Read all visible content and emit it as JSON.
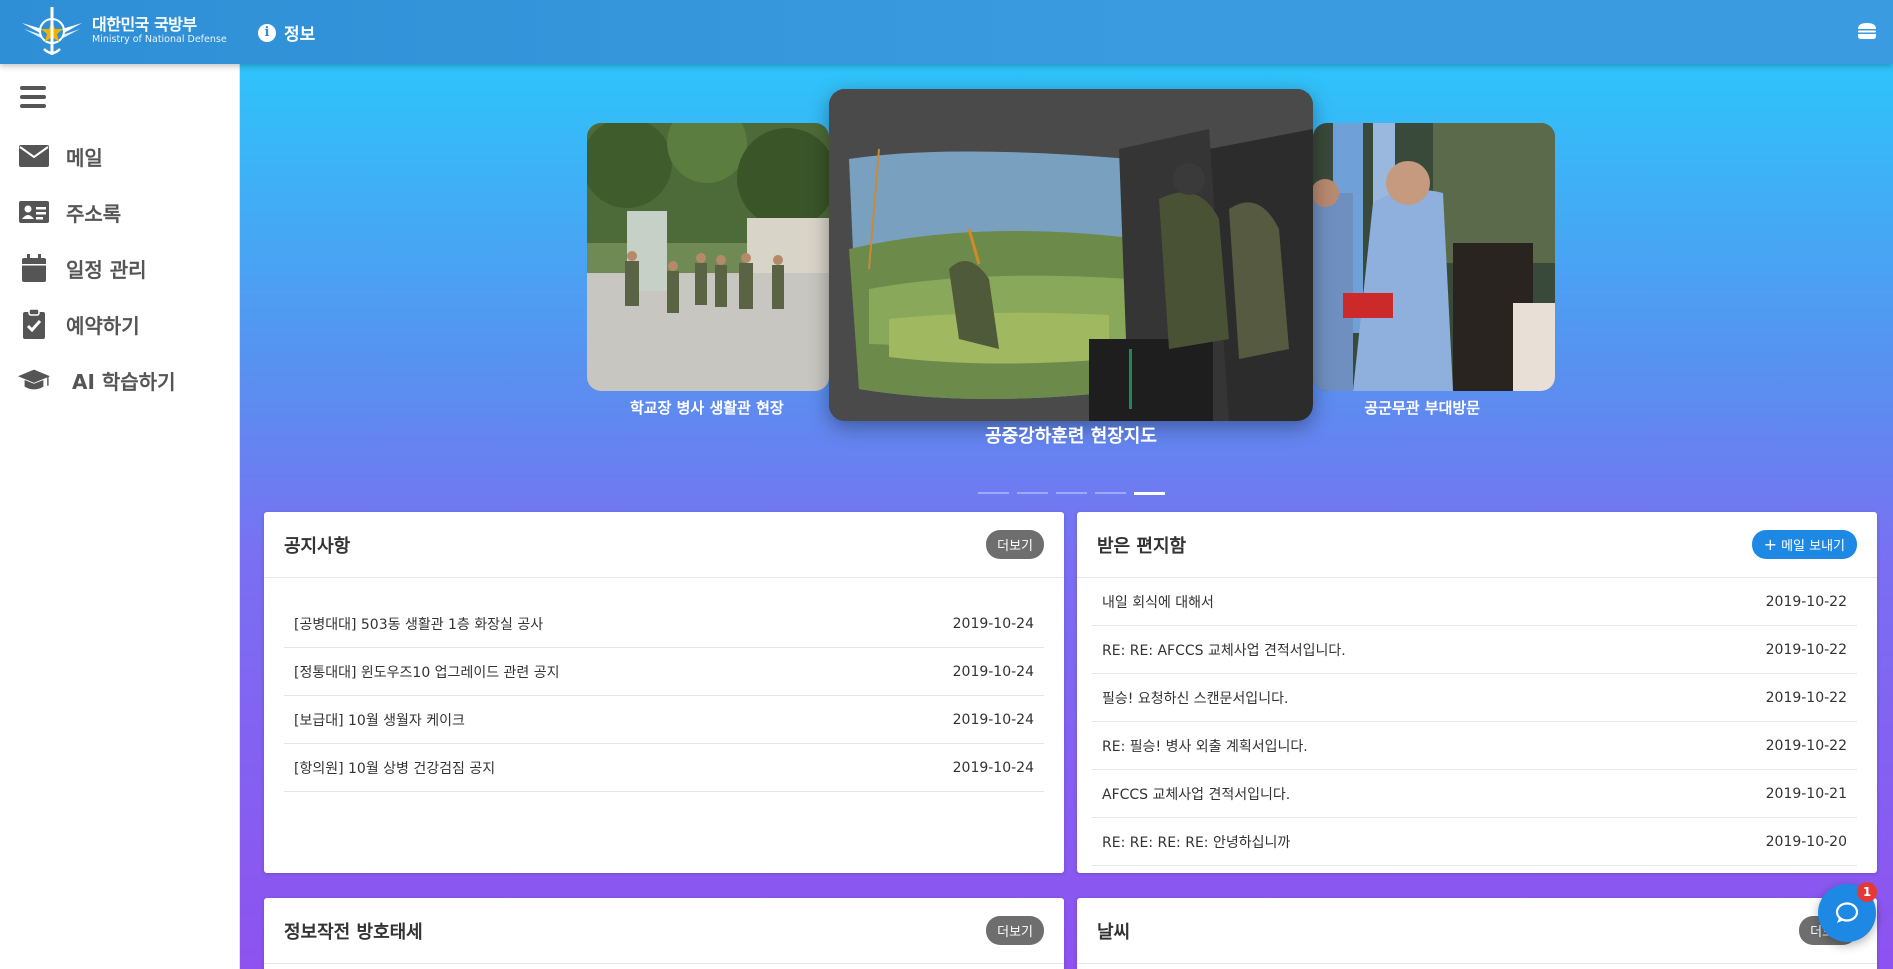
{
  "header": {
    "logo_ko": "대한민국 국방부",
    "logo_en": "Ministry of National Defense",
    "info_label": "정보",
    "info_icon": "info-circle-icon",
    "menu_icon": "hamburger-icon",
    "bg_color": "#2f8fd6"
  },
  "sidebar": {
    "items": [
      {
        "label": "메일",
        "icon": "envelope-icon"
      },
      {
        "label": "주소록",
        "icon": "address-card-icon"
      },
      {
        "label": "일정 관리",
        "icon": "calendar-icon"
      },
      {
        "label": "예약하기",
        "icon": "clipboard-check-icon"
      },
      {
        "label": "AI 학습하기",
        "icon": "graduation-cap-icon"
      }
    ]
  },
  "carousel": {
    "left_caption": "학교장 병사 생활관 현장",
    "center_caption": "공중강하훈련 현장지도",
    "right_caption": "공군무관 부대방문",
    "slide_count": 5,
    "active_index": 4
  },
  "notices": {
    "title": "공지사항",
    "more_label": "더보기",
    "rows": [
      {
        "title": "[공병대대] 503동 생활관 1층 화장실 공사",
        "date": "2019-10-24"
      },
      {
        "title": "[정통대대] 윈도우즈10 업그레이드 관련 공지",
        "date": "2019-10-24"
      },
      {
        "title": "[보급대] 10월 생월자 케이크",
        "date": "2019-10-24"
      },
      {
        "title": "[항의원] 10월 상병 건강검짐 공지",
        "date": "2019-10-24"
      }
    ]
  },
  "inbox": {
    "title": "받은 편지함",
    "send_label": "메일 보내기",
    "rows": [
      {
        "title": "내일 회식에 대해서",
        "date": "2019-10-22"
      },
      {
        "title": "RE: RE: AFCCS 교체사업 견적서입니다.",
        "date": "2019-10-22"
      },
      {
        "title": "필승! 요청하신 스캔문서입니다.",
        "date": "2019-10-22"
      },
      {
        "title": "RE: 필승! 병사 외출 계획서입니다.",
        "date": "2019-10-22"
      },
      {
        "title": "AFCCS 교체사업 견적서입니다.",
        "date": "2019-10-21"
      },
      {
        "title": "RE: RE: RE: RE: 안녕하십니까",
        "date": "2019-10-20"
      }
    ]
  },
  "infosec": {
    "title": "정보작전 방호태세",
    "more_label": "더보기"
  },
  "weather": {
    "title": "날씨",
    "more_label": "더보기"
  },
  "chat": {
    "badge": "1",
    "icon": "chat-bubble-icon"
  }
}
